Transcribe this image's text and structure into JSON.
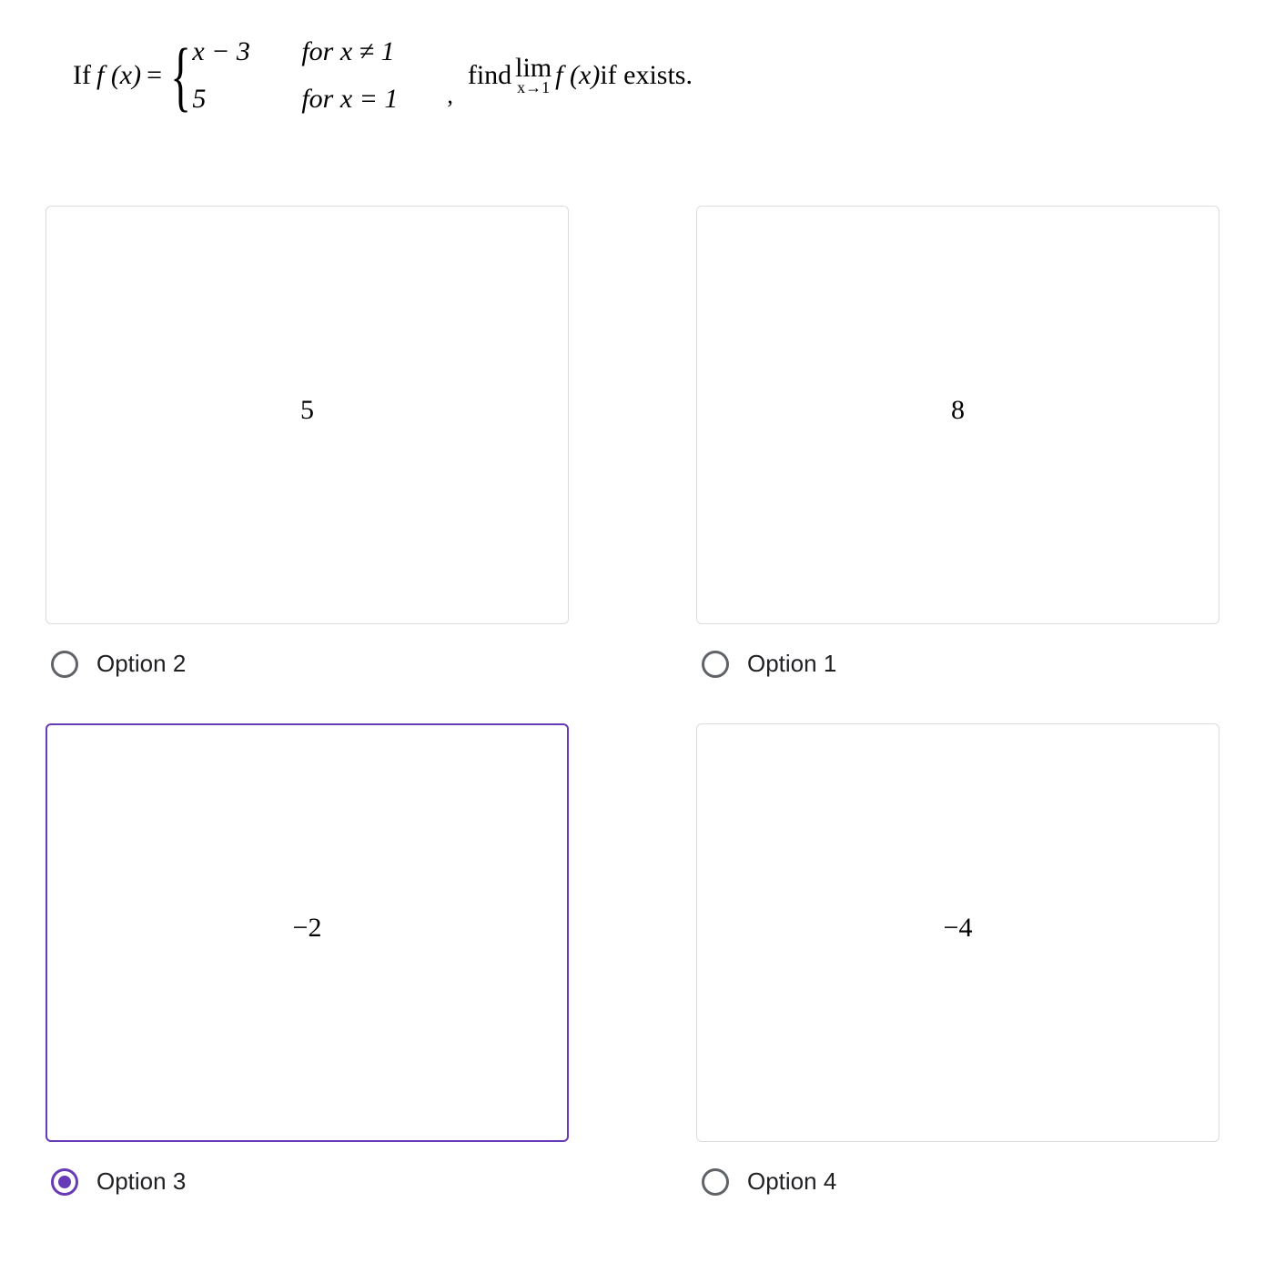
{
  "question": {
    "if_text": "If",
    "fx": "f (x)",
    "eq": "=",
    "piece1_expr": "x − 3",
    "piece1_cond": "for x ≠ 1",
    "piece2_expr": "5",
    "piece2_cond": "for x = 1",
    "comma": ",",
    "find_text": "find",
    "lim_text": "lim",
    "lim_sub": "x→1",
    "lim_fx": "f (x)",
    "if_exists": " if exists."
  },
  "options": [
    {
      "value": "5",
      "label": "Option 2",
      "selected": false
    },
    {
      "value": "8",
      "label": "Option 1",
      "selected": false
    },
    {
      "value": "−2",
      "label": "Option 3",
      "selected": true
    },
    {
      "value": "−4",
      "label": "Option 4",
      "selected": false
    }
  ]
}
